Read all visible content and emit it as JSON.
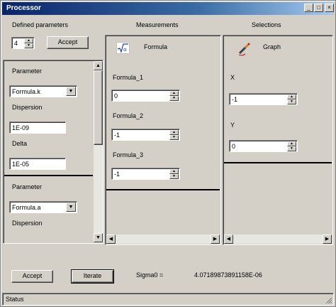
{
  "window": {
    "title": "Processor",
    "controls": {
      "minimize": "_",
      "maximize": "□",
      "close": "×"
    }
  },
  "header": {
    "defined_parameters_label": "Defined parameters",
    "defined_parameters_value": "4",
    "accept_top_label": "Accept",
    "measurements_label": "Measurements",
    "selections_label": "Selections"
  },
  "parameters": [
    {
      "parameter_label": "Parameter",
      "parameter_value": "Formula.k",
      "dispersion_label": "Dispersion",
      "dispersion_value": "1E-09",
      "delta_label": "Delta",
      "delta_value": "1E-05"
    },
    {
      "parameter_label": "Parameter",
      "parameter_value": "Formula.a",
      "dispersion_label": "Dispersion"
    }
  ],
  "measurements": {
    "header_label": "Formula",
    "header_icon": "sqrt-alpha-icon",
    "items": [
      {
        "label": "Formula_1",
        "value": "0"
      },
      {
        "label": "Formula_2",
        "value": "-1"
      },
      {
        "label": "Formula_3",
        "value": "-1"
      }
    ]
  },
  "selections": {
    "header_label": "Graph",
    "header_icon": "graph-pen-icon",
    "items": [
      {
        "label": "X",
        "value": "-1"
      },
      {
        "label": "Y",
        "value": "0"
      }
    ]
  },
  "footer": {
    "accept_label": "Accept",
    "iterate_label": "Iterate",
    "sigma_label": "Sigma0 =",
    "sigma_value": "4.07189873891158E-06"
  },
  "status": {
    "text": "Status"
  }
}
